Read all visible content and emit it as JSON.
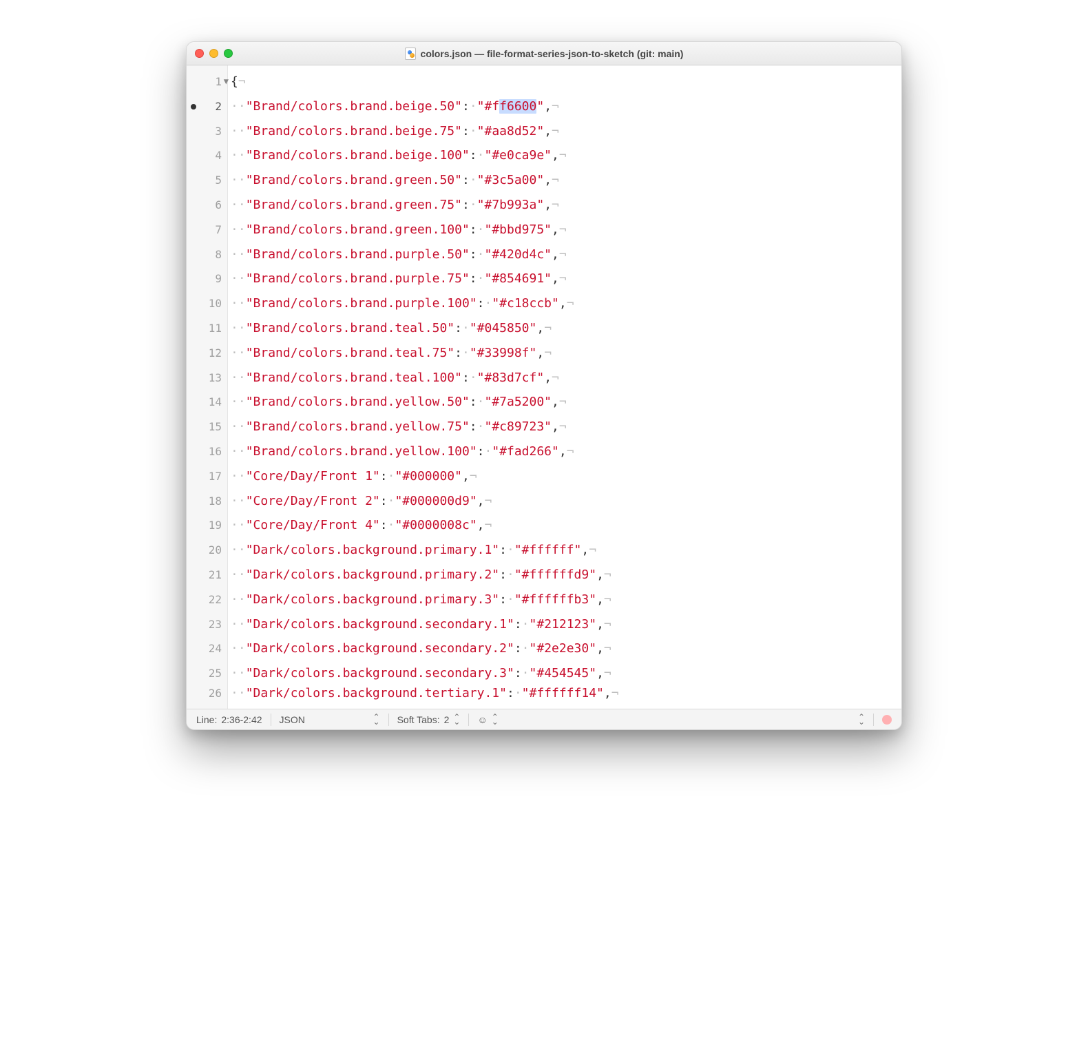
{
  "window": {
    "title": "colors.json — file-format-series-json-to-sketch (git: main)"
  },
  "gutter": {
    "active_line": 2,
    "bullet_line": 2,
    "fold_line": 1
  },
  "code_lines": [
    {
      "n": 1,
      "kind": "open",
      "text": "{"
    },
    {
      "n": 2,
      "kind": "kv",
      "key": "Brand/colors.brand.beige.50",
      "value": "#ff6600",
      "sel_start": 2,
      "sel_len": 6
    },
    {
      "n": 3,
      "kind": "kv",
      "key": "Brand/colors.brand.beige.75",
      "value": "#aa8d52"
    },
    {
      "n": 4,
      "kind": "kv",
      "key": "Brand/colors.brand.beige.100",
      "value": "#e0ca9e"
    },
    {
      "n": 5,
      "kind": "kv",
      "key": "Brand/colors.brand.green.50",
      "value": "#3c5a00"
    },
    {
      "n": 6,
      "kind": "kv",
      "key": "Brand/colors.brand.green.75",
      "value": "#7b993a"
    },
    {
      "n": 7,
      "kind": "kv",
      "key": "Brand/colors.brand.green.100",
      "value": "#bbd975"
    },
    {
      "n": 8,
      "kind": "kv",
      "key": "Brand/colors.brand.purple.50",
      "value": "#420d4c"
    },
    {
      "n": 9,
      "kind": "kv",
      "key": "Brand/colors.brand.purple.75",
      "value": "#854691"
    },
    {
      "n": 10,
      "kind": "kv",
      "key": "Brand/colors.brand.purple.100",
      "value": "#c18ccb"
    },
    {
      "n": 11,
      "kind": "kv",
      "key": "Brand/colors.brand.teal.50",
      "value": "#045850"
    },
    {
      "n": 12,
      "kind": "kv",
      "key": "Brand/colors.brand.teal.75",
      "value": "#33998f"
    },
    {
      "n": 13,
      "kind": "kv",
      "key": "Brand/colors.brand.teal.100",
      "value": "#83d7cf"
    },
    {
      "n": 14,
      "kind": "kv",
      "key": "Brand/colors.brand.yellow.50",
      "value": "#7a5200"
    },
    {
      "n": 15,
      "kind": "kv",
      "key": "Brand/colors.brand.yellow.75",
      "value": "#c89723"
    },
    {
      "n": 16,
      "kind": "kv",
      "key": "Brand/colors.brand.yellow.100",
      "value": "#fad266"
    },
    {
      "n": 17,
      "kind": "kv",
      "key": "Core/Day/Front 1",
      "value": "#000000"
    },
    {
      "n": 18,
      "kind": "kv",
      "key": "Core/Day/Front 2",
      "value": "#000000d9"
    },
    {
      "n": 19,
      "kind": "kv",
      "key": "Core/Day/Front 4",
      "value": "#0000008c"
    },
    {
      "n": 20,
      "kind": "kv",
      "key": "Dark/colors.background.primary.1",
      "value": "#ffffff"
    },
    {
      "n": 21,
      "kind": "kv",
      "key": "Dark/colors.background.primary.2",
      "value": "#ffffffd9"
    },
    {
      "n": 22,
      "kind": "kv",
      "key": "Dark/colors.background.primary.3",
      "value": "#ffffffb3"
    },
    {
      "n": 23,
      "kind": "kv",
      "key": "Dark/colors.background.secondary.1",
      "value": "#212123"
    },
    {
      "n": 24,
      "kind": "kv",
      "key": "Dark/colors.background.secondary.2",
      "value": "#2e2e30"
    },
    {
      "n": 25,
      "kind": "kv",
      "key": "Dark/colors.background.secondary.3",
      "value": "#454545"
    },
    {
      "n": 26,
      "kind": "kv",
      "key": "Dark/colors.background.tertiary.1",
      "value": "#ffffff14",
      "cut": true
    }
  ],
  "status": {
    "line_label": "Line:",
    "line_value": "2:36-2:42",
    "syntax": "JSON",
    "tabs_label": "Soft Tabs:",
    "tabs_value": "2"
  }
}
